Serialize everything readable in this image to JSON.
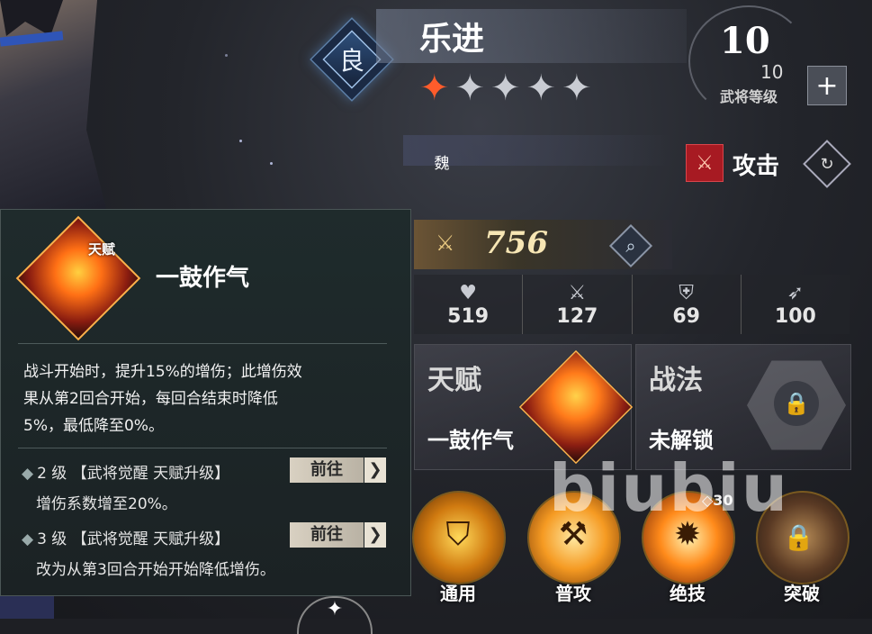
{
  "hero": {
    "rank": "良",
    "name": "乐进",
    "stars_total": 5,
    "stars_lit": 1,
    "faction": "魏",
    "level": "10",
    "level_max": "10",
    "level_label": "武将等级",
    "role": "攻击"
  },
  "power": {
    "value": "756"
  },
  "stats": [
    {
      "icon": "heart-icon",
      "value": "519"
    },
    {
      "icon": "crossed-swords-icon",
      "value": "127"
    },
    {
      "icon": "shield-icon",
      "value": "69"
    },
    {
      "icon": "boot-icon",
      "value": "100"
    }
  ],
  "talent_card": {
    "heading": "天赋",
    "name": "一鼓作气"
  },
  "tactic_card": {
    "heading": "战法",
    "name": "未解锁"
  },
  "skills": [
    {
      "label": "通用"
    },
    {
      "label": "普攻"
    },
    {
      "label": "绝技",
      "cost": "◇30"
    },
    {
      "label": "突破"
    }
  ],
  "watermark": "biubiu",
  "tooltip": {
    "tag": "天赋",
    "title": "一鼓作气",
    "desc_lines": [
      "战斗开始时，提升15%的增伤；此增伤效",
      "果从第2回合开始，每回合结束时降低",
      "5%，最低降至0%。"
    ],
    "upgrades": [
      {
        "text": "2 级 【武将觉醒 天赋升级】",
        "button": "前往",
        "detail": "增伤系数增至20%。"
      },
      {
        "text": "3 级 【武将觉醒 天赋升级】",
        "button": "前往",
        "detail": "改为从第3回合开始开始降低增伤。"
      }
    ]
  },
  "colors": {
    "star_on": "#ff5c2b",
    "star_off": "#c9ccd3",
    "role": "#a71a22",
    "faction": "#3b3f86"
  }
}
